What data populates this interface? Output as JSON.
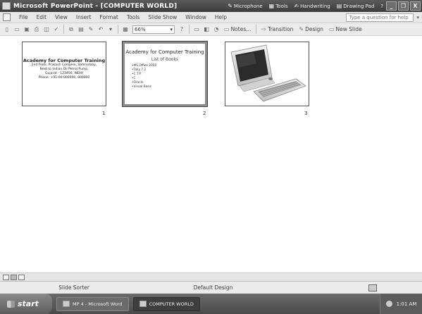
{
  "window": {
    "title": "Microsoft PowerPoint - [COMPUTER WORLD]",
    "language_bar": [
      {
        "icon": "microphone-icon",
        "label": "Microphone"
      },
      {
        "icon": "tools-icon",
        "label": "Tools"
      },
      {
        "icon": "handwriting-icon",
        "label": "Handwriting"
      },
      {
        "icon": "drawing-pad-icon",
        "label": "Drawing Pad"
      }
    ],
    "controls": {
      "minimize": "_",
      "restore": "❐",
      "close": "X"
    }
  },
  "menu": {
    "items": [
      "File",
      "Edit",
      "View",
      "Insert",
      "Format",
      "Tools",
      "Slide Show",
      "Window",
      "Help"
    ],
    "help_placeholder": "Type a question for help"
  },
  "toolbar": {
    "zoom": "66%",
    "notes_label": "Notes...",
    "transition_label": "Transition",
    "design_label": "Design",
    "new_slide_label": "New Slide"
  },
  "slides": [
    {
      "number": "1",
      "title": "Academy for Computer Training",
      "lines": [
        "2nd Floor, Prakash Complex, Samrodaay,",
        "Next to Indian Oil Petrol Pump,",
        "Gujarat - 123456, INDIA",
        "Phone: +91-00-000000, 000000"
      ]
    },
    {
      "number": "2",
      "title": "Academy for Computer Training",
      "subtitle": "List of Books",
      "bullets": [
        "MS Office 2000",
        "Tally 7.2",
        "C.T.P.",
        "C",
        "Oracle",
        "Visual Basic"
      ]
    },
    {
      "number": "3",
      "image": "computer-keyboard-image"
    }
  ],
  "status": {
    "view": "Slide Sorter",
    "design": "Default Design"
  },
  "taskbar": {
    "start_label": "start",
    "tasks": [
      {
        "label": "MP 4 - Microsoft Word",
        "active": false
      },
      {
        "label": "COMPUTER WORLD",
        "active": true
      }
    ],
    "clock": "1:01 AM"
  }
}
